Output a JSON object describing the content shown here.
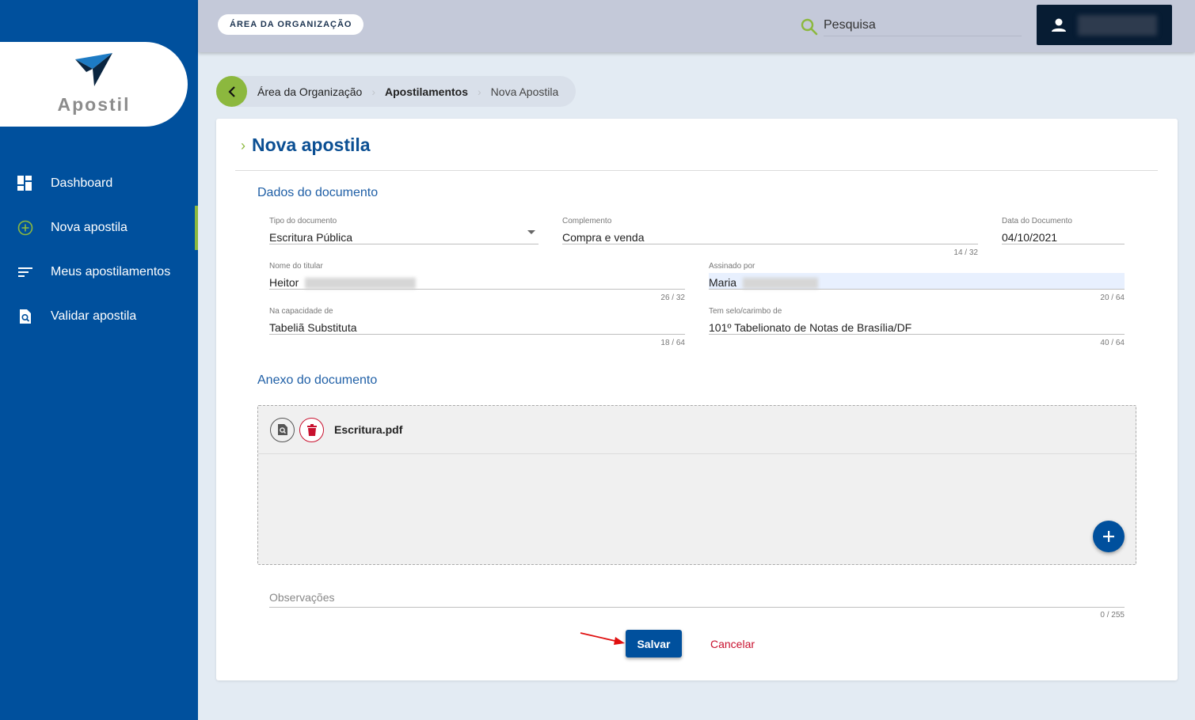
{
  "app": {
    "name": "Apostil"
  },
  "sidebar": {
    "items": [
      {
        "label": "Dashboard",
        "icon": "dashboard-icon"
      },
      {
        "label": "Nova apostila",
        "icon": "add-circle-icon",
        "active": true
      },
      {
        "label": "Meus apostilamentos",
        "icon": "list-icon"
      },
      {
        "label": "Validar apostila",
        "icon": "search-document-icon"
      }
    ]
  },
  "header": {
    "org_chip": "ÁREA DA ORGANIZAÇÃO",
    "search_placeholder": "Pesquisa"
  },
  "breadcrumb": [
    "Área da Organização",
    "Apostilamentos",
    "Nova Apostila"
  ],
  "page": {
    "title": "Nova apostila",
    "section_document": "Dados do documento",
    "section_attachment": "Anexo do documento"
  },
  "form": {
    "tipo": {
      "label": "Tipo do documento",
      "value": "Escritura Pública"
    },
    "complemento": {
      "label": "Complemento",
      "value": "Compra e venda",
      "counter": "14 / 32"
    },
    "data": {
      "label": "Data do Documento",
      "value": "04/10/2021"
    },
    "nome": {
      "label": "Nome do titular",
      "value": "Heitor",
      "counter": "26 / 32"
    },
    "assinado": {
      "label": "Assinado por",
      "value": "Maria",
      "counter": "20 / 64"
    },
    "capacidade": {
      "label": "Na capacidade de",
      "value": "Tabeliã Substituta",
      "counter": "18 / 64"
    },
    "selo": {
      "label": "Tem selo/carimbo de",
      "value": "101º Tabelionato de Notas de Brasília/DF",
      "counter": "40 / 64"
    },
    "observacoes": {
      "placeholder": "Observações",
      "counter": "0 / 255"
    }
  },
  "attachment": {
    "file_name": "Escritura.pdf"
  },
  "actions": {
    "save": "Salvar",
    "cancel": "Cancelar"
  },
  "colors": {
    "sidebar": "#00509d",
    "accent": "#8cb83e",
    "danger": "#c8102e",
    "title": "#0b4f93"
  }
}
